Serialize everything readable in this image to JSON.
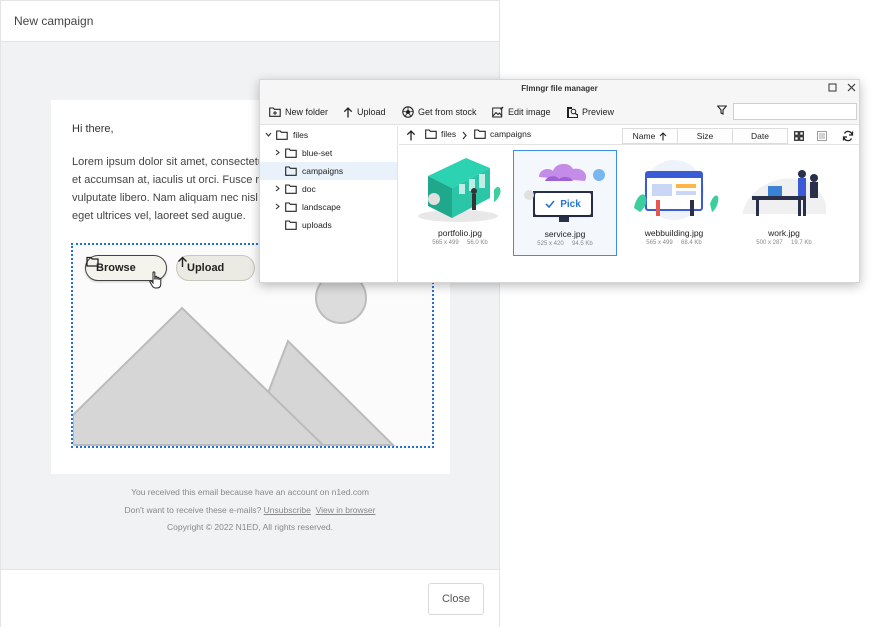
{
  "campaign": {
    "title": "New campaign",
    "close_label": "Close",
    "email": {
      "greeting": "Hi there,",
      "body_lines": [
        "Lorem ipsum dolor sit amet, consectetur a",
        "et accumsan at, iaculis ut orci. Fusce non",
        "vulputate libero. Nam aliquam nec nisl et v",
        "eget ultrices vel, laoreet sed augue."
      ],
      "browse_label": "Browse",
      "upload_label": "Upload"
    },
    "footer": {
      "line1": "You received this email because have an account on n1ed.com",
      "line2_prefix": "Don't want to receive these e-mails?",
      "unsubscribe": "Unsubscribe",
      "view_in_browser": "View in browser",
      "copyright": "Copyright © 2022 N1ED, All rights reserved."
    }
  },
  "file_manager": {
    "title": "Flmngr file manager",
    "toolbar": {
      "new_folder": "New folder",
      "upload": "Upload",
      "get_from_stock": "Get from stock",
      "edit_image": "Edit image",
      "preview": "Preview",
      "search_value": ""
    },
    "tree": [
      {
        "label": "files",
        "level": 0,
        "arrow": "expanded"
      },
      {
        "label": "blue-set",
        "level": 1,
        "arrow": "collapsed"
      },
      {
        "label": "campaigns",
        "level": 1,
        "arrow": "none",
        "selected": true
      },
      {
        "label": "doc",
        "level": 1,
        "arrow": "collapsed"
      },
      {
        "label": "landscape",
        "level": 1,
        "arrow": "collapsed"
      },
      {
        "label": "uploads",
        "level": 1,
        "arrow": "none"
      }
    ],
    "path": [
      "files",
      "campaigns"
    ],
    "sort": {
      "name": "Name",
      "size": "Size",
      "date": "Date"
    },
    "pick_label": "Pick",
    "files": [
      {
        "name": "portfolio.jpg",
        "dims": "565 x 499",
        "size": "56.0 Kb"
      },
      {
        "name": "service.jpg",
        "dims": "525 x 420",
        "size": "94.5 Kb",
        "selected": true
      },
      {
        "name": "webbuilding.jpg",
        "dims": "565 x 499",
        "size": "68.4 Kb"
      },
      {
        "name": "work.jpg",
        "dims": "500 x 287",
        "size": "19.7 Kb"
      }
    ]
  }
}
